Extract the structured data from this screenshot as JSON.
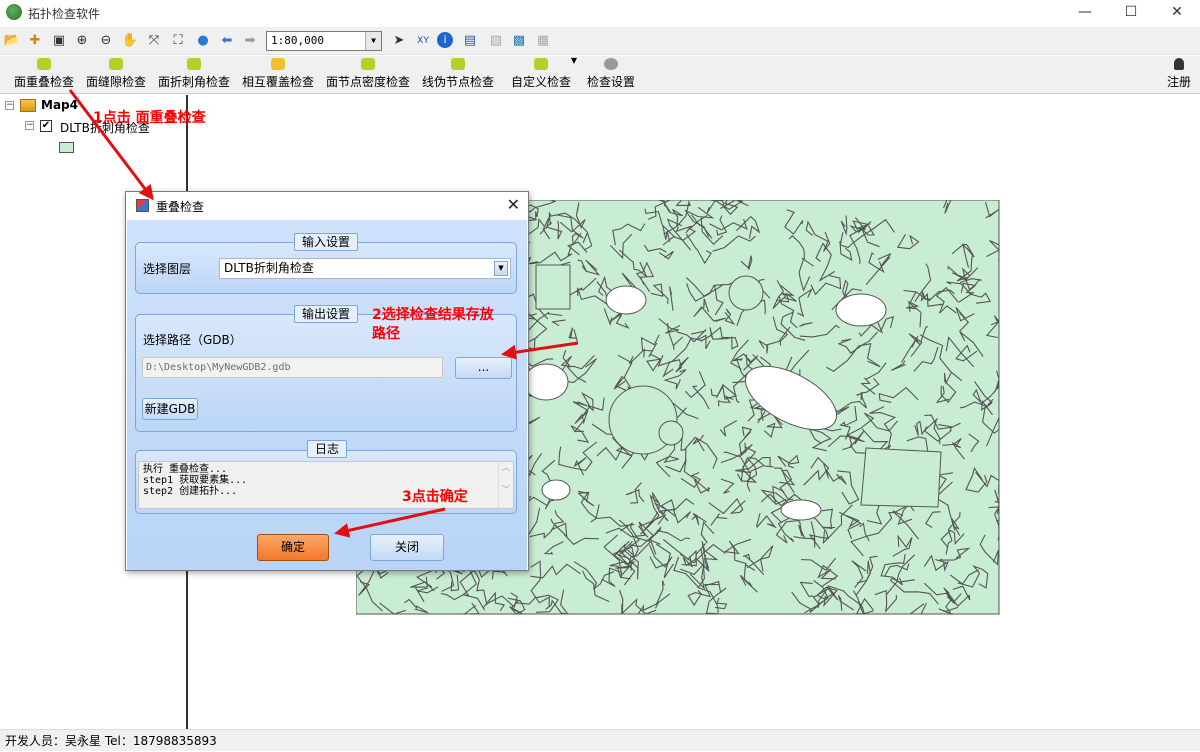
{
  "window": {
    "title": "拓扑检查软件",
    "minimize": "—",
    "maximize": "☐",
    "close": "✕"
  },
  "toolbar1": {
    "icons": [
      "open-icon",
      "add-data-icon",
      "save-icon",
      "zoom-in-icon",
      "zoom-out-icon",
      "pan-icon",
      "full-extent-icon",
      "zoom-extent-icon",
      "globe-icon",
      "back-icon",
      "forward-icon"
    ],
    "scale": "1:80,000",
    "icons2": [
      "select-icon",
      "xy-icon",
      "identify-icon",
      "measure-icon",
      "layout-icon",
      "map-icon",
      "export-icon"
    ]
  },
  "toolbar2": {
    "items": [
      {
        "label": "面重叠检查"
      },
      {
        "label": "面缝隙检查"
      },
      {
        "label": "面折刺角检查"
      },
      {
        "label": "相互覆盖检查"
      },
      {
        "label": "面节点密度检查"
      },
      {
        "label": "线伪节点检查"
      },
      {
        "label": "自定义检查"
      },
      {
        "label": "检查设置"
      }
    ],
    "register": "注册"
  },
  "tree": {
    "root": "Map4",
    "layer": "DLTB折刺角检查"
  },
  "dialog": {
    "title": "重叠检查",
    "input_group": "输入设置",
    "layer_label": "选择图层",
    "layer_value": "DLTB折刺角检查",
    "output_group": "输出设置",
    "path_label": "选择路径（GDB）",
    "path_value": "D:\\Desktop\\MyNewGDB2.gdb",
    "browse_label": "...",
    "new_gdb_label": "新建GDB",
    "log_group": "日志",
    "log_lines": [
      "执行 重叠检查...",
      "step1 获取要素集...",
      "step2 创建拓扑..."
    ],
    "ok_label": "确定",
    "close_label": "关闭"
  },
  "annotations": {
    "a1": "1点击 面重叠检查",
    "a2_line1": "2选择检查结果存放",
    "a2_line2": "路径",
    "a3": "3点击确定"
  },
  "status": {
    "developer": "开发人员：吴永星 Tel：18798835893"
  },
  "colors": {
    "polygon_fill": "#c9edd3",
    "polygon_edge": "#555555",
    "annotation": "#ff0000",
    "ok_button": "#f58a3c"
  }
}
